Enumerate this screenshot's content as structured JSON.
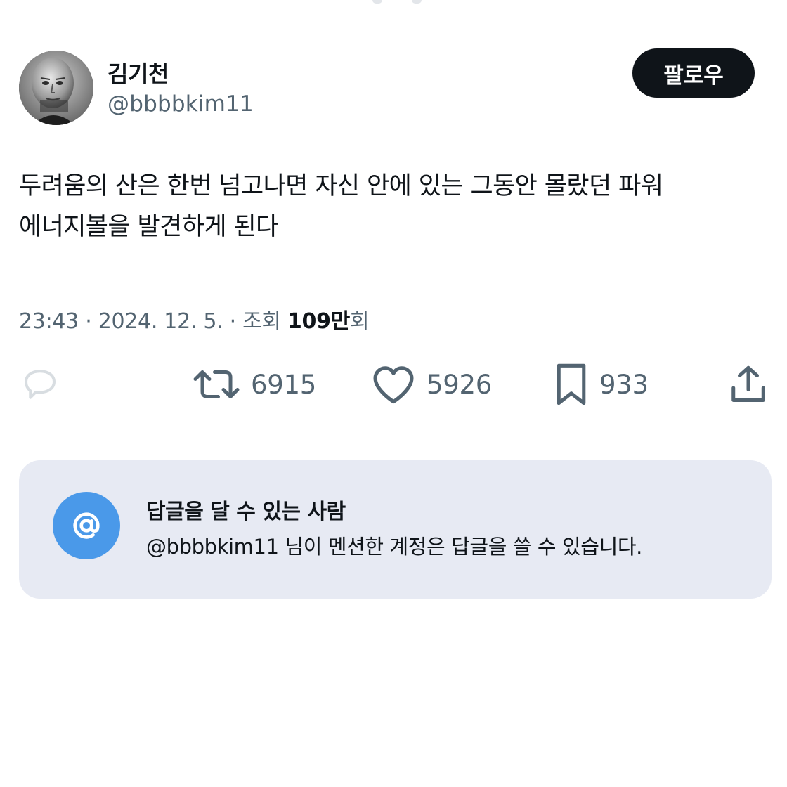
{
  "user": {
    "display_name": "김기천",
    "handle": "@bbbbkim11",
    "follow_label": "팔로우"
  },
  "tweet": {
    "text_line1": "두려움의 산은 한번 넘고나면 자신 안에 있는 그동안 몰랐던 파워",
    "text_line2": "에너지볼을 발견하게 된다"
  },
  "meta": {
    "time": "23:43",
    "separator": " · ",
    "date": "2024. 12. 5.",
    "views_label": "조회",
    "views_count": "109만",
    "views_suffix": "회"
  },
  "actions": {
    "reply": {
      "icon": "reply-icon",
      "count": ""
    },
    "retweet": {
      "icon": "retweet-icon",
      "count": "6915"
    },
    "like": {
      "icon": "heart-icon",
      "count": "5926"
    },
    "bookmark": {
      "icon": "bookmark-icon",
      "count": "933"
    },
    "share": {
      "icon": "share-icon"
    }
  },
  "reply_restriction": {
    "icon": "at-icon",
    "title": "답글을 달 수 있는 사람",
    "description": "@bbbbkim11 님이 멘션한 계정은 답글을 쓸 수 있습니다."
  },
  "colors": {
    "text_primary": "#0f1419",
    "text_secondary": "#536471",
    "follow_button_bg": "#0f1419",
    "card_bg": "#e7eaf3",
    "at_circle_bg": "#4a99e9",
    "divider": "#cfd9de"
  }
}
